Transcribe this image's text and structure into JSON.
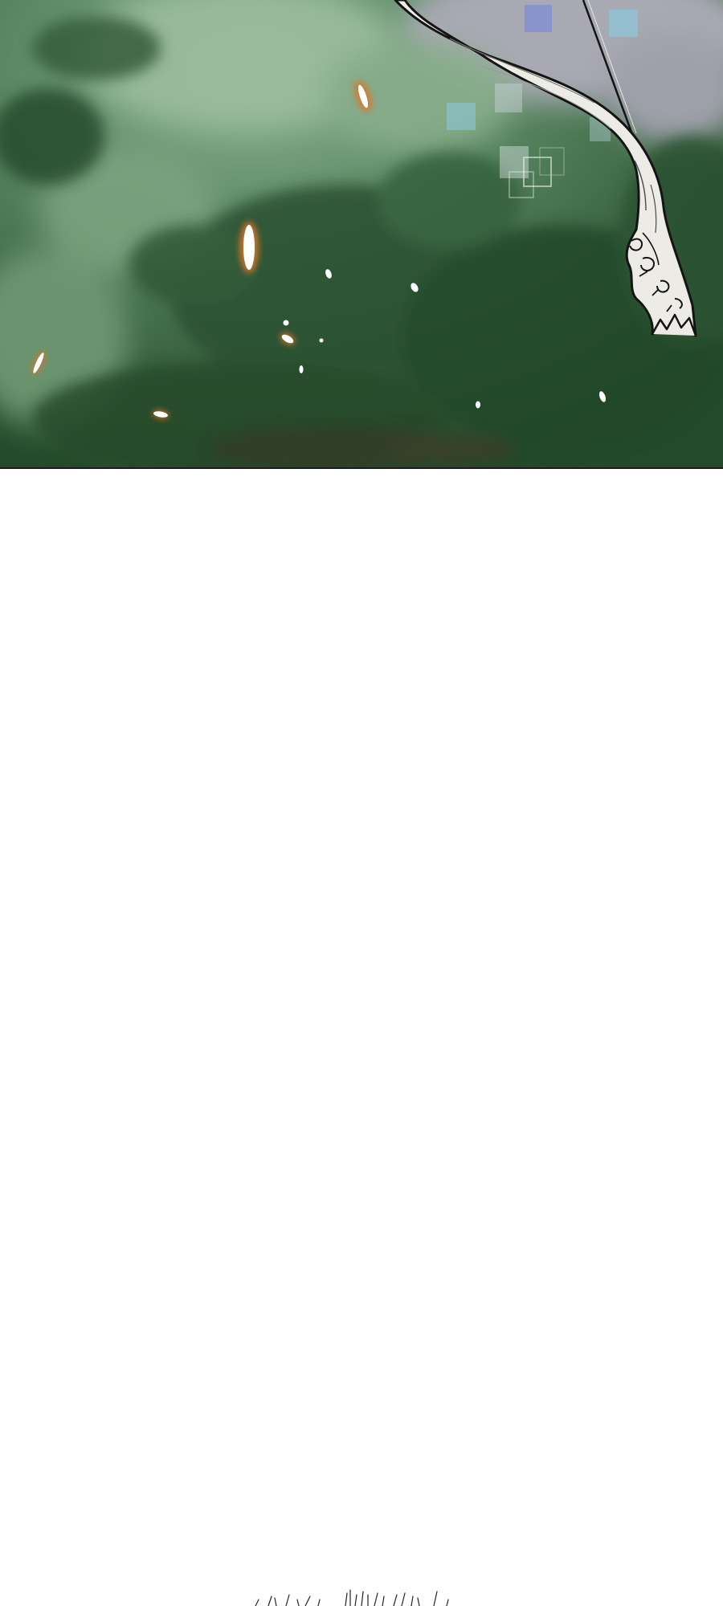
{
  "scene": {
    "panel_1": {
      "background": "forest-foliage",
      "object": "tail-whip",
      "effects": [
        "ember-sparks",
        "pixel-squares"
      ]
    },
    "panel_2": {
      "visible": "grass-tips"
    }
  },
  "colors": {
    "foliage_light": "#6f9a78",
    "foliage_mid": "#3f6b47",
    "foliage_dark": "#1f3d24",
    "sky_grey": "#a9a9b4",
    "tail_fill": "#ecebe6",
    "outline": "#141414",
    "ember_core": "#ffffff",
    "ember_glow": "#d9772a",
    "pixel_square": "#8fc6d8",
    "gutter": "#ffffff"
  }
}
